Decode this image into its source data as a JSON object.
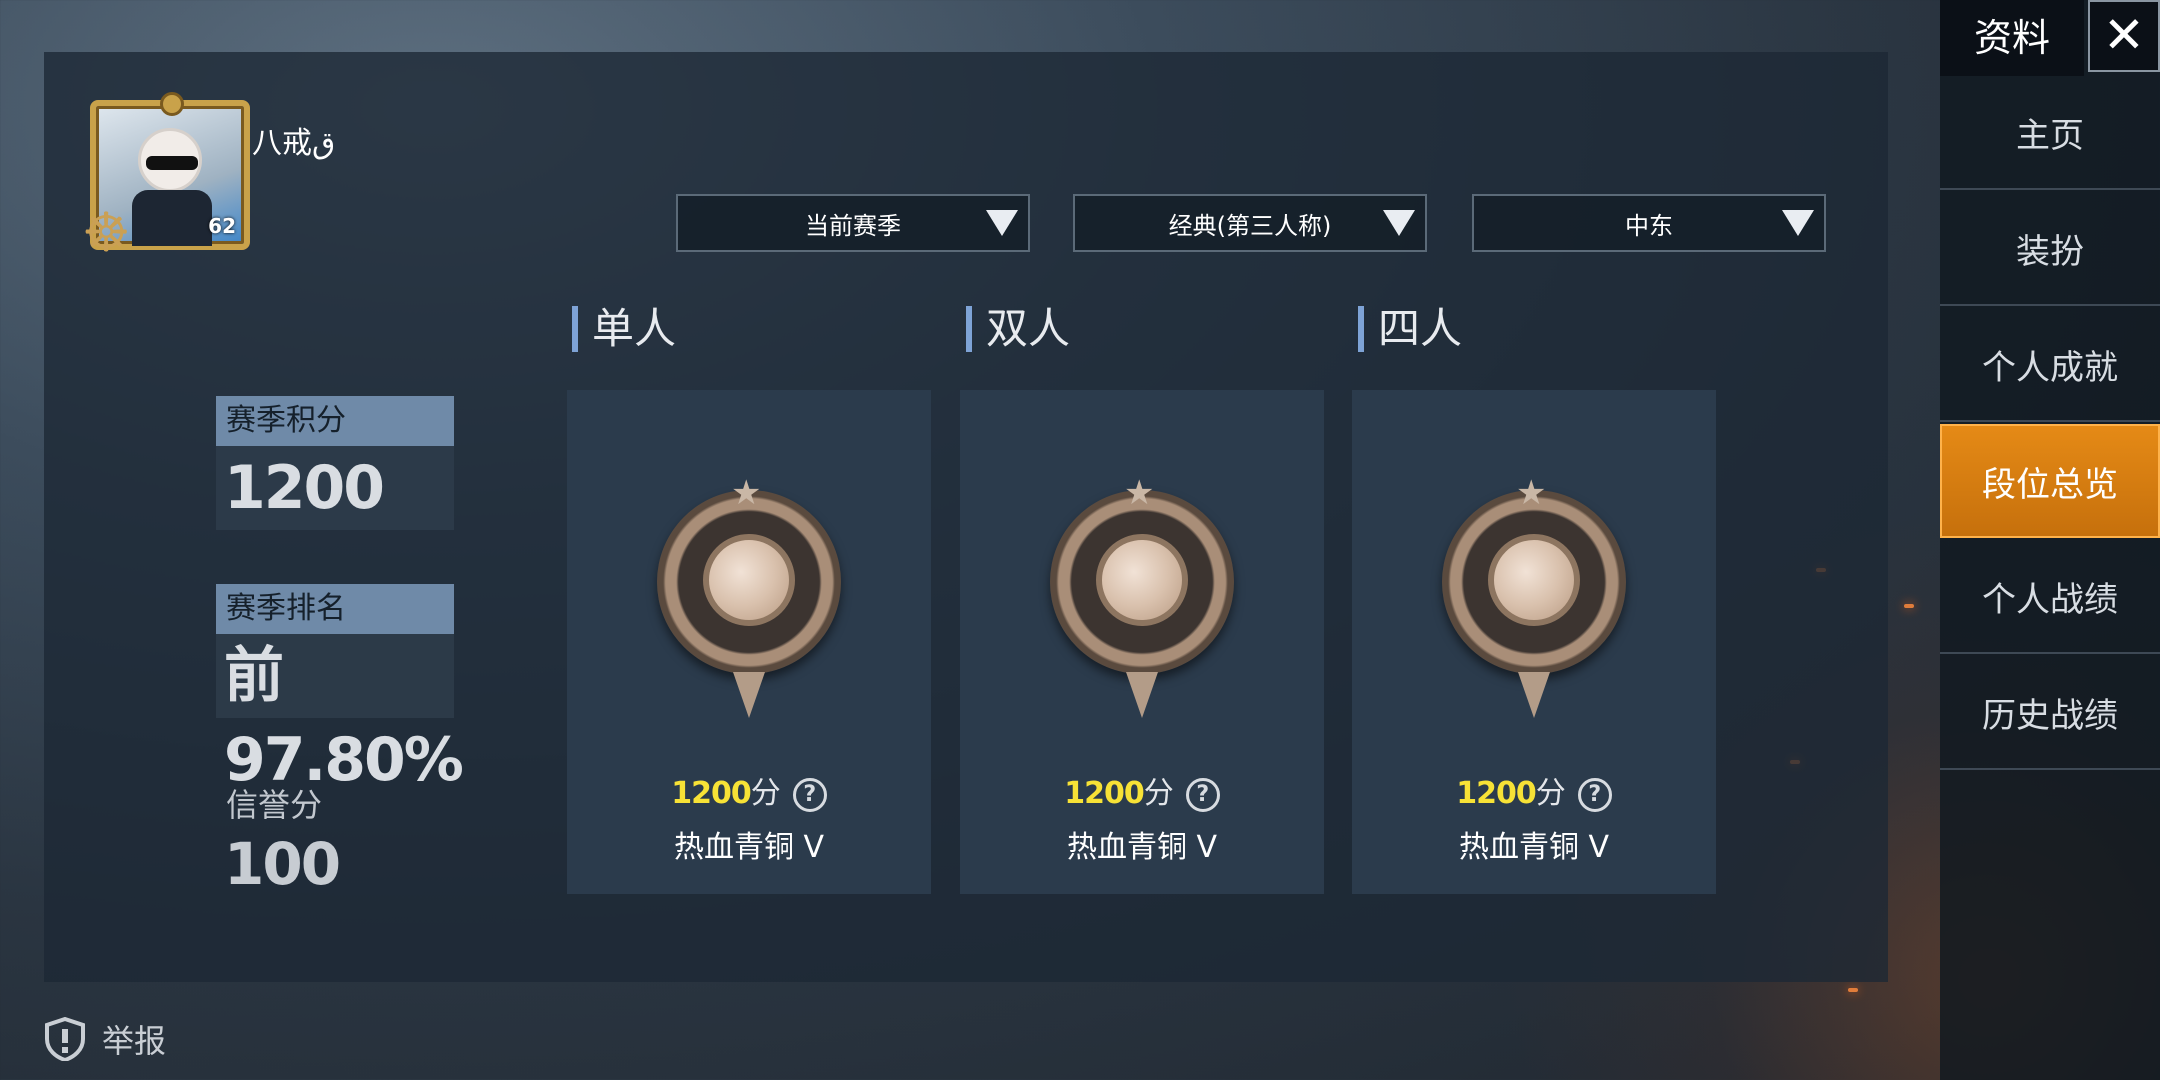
{
  "player": {
    "name": "八戒ق",
    "level": "62"
  },
  "filters": {
    "season": "当前赛季",
    "mode": "经典(第三人称)",
    "region": "中东"
  },
  "stats": {
    "season_points_label": "赛季积分",
    "season_points_value": "1200",
    "season_rank_label": "赛季排名",
    "season_rank_value": "前97.80%",
    "credit_label": "信誉分",
    "credit_value": "100"
  },
  "modes": [
    {
      "title": "单人",
      "points": "1200",
      "points_unit": "分",
      "rank": "热血青铜 V"
    },
    {
      "title": "双人",
      "points": "1200",
      "points_unit": "分",
      "rank": "热血青铜 V"
    },
    {
      "title": "四人",
      "points": "1200",
      "points_unit": "分",
      "rank": "热血青铜 V"
    }
  ],
  "report_label": "举报",
  "sidebar": {
    "title": "资料",
    "close": "✕",
    "items": [
      {
        "label": "主页"
      },
      {
        "label": "装扮"
      },
      {
        "label": "个人成就"
      },
      {
        "label": "段位总览"
      },
      {
        "label": "个人战绩"
      },
      {
        "label": "历史战绩"
      }
    ],
    "active_index": 3
  },
  "colors": {
    "accent_active": "#e58a16",
    "points_yellow": "#f7e236",
    "label_box": "#6f8aa8"
  }
}
